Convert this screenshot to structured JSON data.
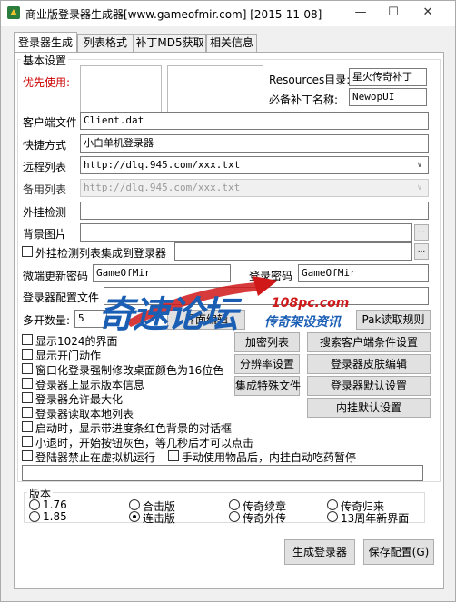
{
  "window": {
    "title": "商业版登录器生成器[www.gameofmir.com] [2015-11-08]",
    "minimize": "—",
    "maximize": "☐",
    "close": "✕"
  },
  "tabs": [
    "登录器生成",
    "列表格式",
    "补丁MD5获取",
    "相关信息"
  ],
  "basic_settings": {
    "group_title": "基本设置",
    "priority_label": "优先使用:",
    "resources_label": "Resources目录:",
    "resources_value": "星火传奇补丁",
    "required_patch_label": "必备补丁名称:",
    "required_patch_value": "NewopUI",
    "client_file_label": "客户端文件",
    "client_file_value": "Client.dat",
    "shortcut_label": "快捷方式",
    "shortcut_value": "小白单机登录器",
    "remote_list_label": "远程列表",
    "remote_list_value": "http://dlq.945.com/xxx.txt",
    "backup_list_label": "备用列表",
    "backup_list_value": "http://dlq.945.com/xxx.txt",
    "cheat_detect_label": "外挂检测",
    "cheat_detect_value": "",
    "bg_image_label": "背景图片",
    "bg_image_value": "",
    "integrate_cheat_list_label": "外挂检测列表集成到登录器",
    "wechat_update_pwd_label": "微端更新密码",
    "wechat_update_pwd_value": "GameOfMir",
    "login_pwd_label": "登录密码",
    "login_pwd_value": "GameOfMir",
    "config_file_label": "登录器配置文件",
    "multi_open_label": "多开数量:",
    "multi_open_value": "5",
    "browse_edit_label": "界面编辑",
    "pak_rule_label": "Pak读取规则"
  },
  "options": [
    "显示1024的界面",
    "显示开门动作",
    "窗口化登录强制修改桌面颜色为16位色",
    "登录器上显示版本信息",
    "登录器允许最大化",
    "登录器读取本地列表",
    "启动时，显示带进度条红色背景的对话框",
    "小退时，开始按钮灰色，等几秒后才可以点击",
    "登陆器禁止在虚拟机运行"
  ],
  "option_auto_potion": "手动使用物品后，内挂自动吃药暂停",
  "mid_buttons": [
    "加密列表",
    "分辨率设置",
    "集成特殊文件"
  ],
  "right_buttons": [
    "搜索客户端条件设置",
    "登录器皮肤编辑",
    "登录器默认设置",
    "内挂默认设置"
  ],
  "version": {
    "group_title": "版本",
    "items": [
      {
        "label": "1.76",
        "checked": false
      },
      {
        "label": "合击版",
        "checked": false
      },
      {
        "label": "传奇续章",
        "checked": false
      },
      {
        "label": "传奇归来",
        "checked": false
      },
      {
        "label": "1.85",
        "checked": false
      },
      {
        "label": "连击版",
        "checked": true
      },
      {
        "label": "传奇外传",
        "checked": false
      },
      {
        "label": "13周年新界面",
        "checked": false
      }
    ]
  },
  "bottom": {
    "generate_label": "生成登录器",
    "save_label": "保存配置(G)"
  },
  "watermark": {
    "main": "奇速论坛",
    "domain": "108pc.com",
    "tagline": "传奇架设资讯"
  },
  "colors": {
    "priority_red": "#cc0000",
    "watermark_blue": "#1b5fb5",
    "watermark_red": "#d01818"
  }
}
